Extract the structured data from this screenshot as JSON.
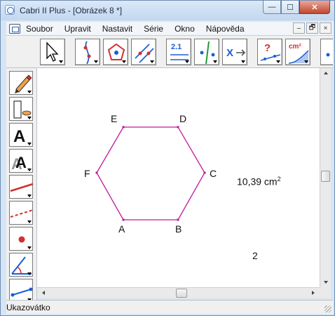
{
  "window": {
    "title": "Cabri II Plus - [Obrázek 8 *]",
    "controls": {
      "minimize": "—",
      "maximize": "☐",
      "close": "✕"
    }
  },
  "menubar": {
    "items": [
      "Soubor",
      "Upravit",
      "Nastavit",
      "Série",
      "Okno",
      "Nápověda"
    ],
    "doc_controls": {
      "minimize": "–",
      "restore": "🗗",
      "close": "×"
    }
  },
  "toolbar": {
    "tools": [
      "pointer-tool",
      "curves-tool",
      "polygon-tool",
      "constructions-tool",
      "measure-number-tool",
      "check-property-tool",
      "transform-tool",
      "macro-question-tool",
      "area-measure-tool",
      "more-tool"
    ],
    "labels": {
      "measure": "2.1",
      "area": "cm²",
      "question": "?"
    }
  },
  "sidebar": {
    "tools": [
      "pencil-tool",
      "hide-show-tool",
      "text-tool",
      "text-style-tool",
      "line-tool",
      "dashed-line-tool",
      "point-tool",
      "angle-tool",
      "segment-tool"
    ],
    "labels": {
      "text": "A",
      "text_style": "A"
    }
  },
  "canvas": {
    "point_labels": {
      "A": "A",
      "B": "B",
      "C": "C",
      "D": "D",
      "E": "E",
      "F": "F"
    },
    "area_value": "10,39 cm",
    "area_unit_exp": "2",
    "number_value": "2",
    "hexagon_color": "#c0189a",
    "vertex_color": "#c0189a"
  },
  "status": {
    "text": "Ukazovátko"
  }
}
